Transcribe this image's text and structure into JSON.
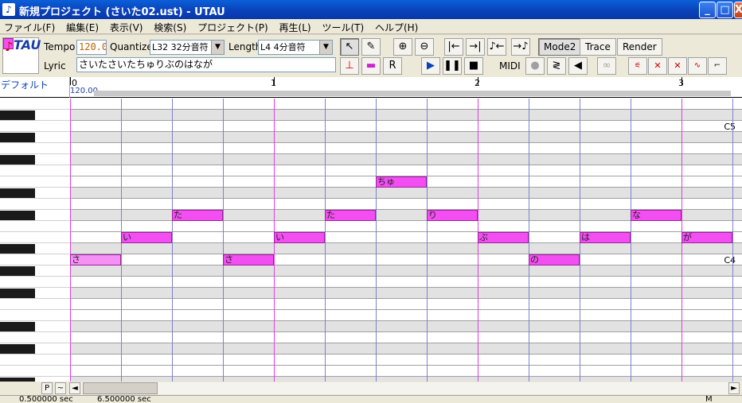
{
  "window": {
    "app_icon": "♪",
    "title": "新規プロジェクト (さいた02.ust) - UTAU",
    "minimize": "_",
    "maximize": "□",
    "close": "X"
  },
  "menu": [
    "ファイル(F)",
    "編集(E)",
    "表示(V)",
    "検索(S)",
    "プロジェクト(P)",
    "再生(L)",
    "ツール(T)",
    "ヘルプ(H)"
  ],
  "toolbar": {
    "logo_note": "♪",
    "logo_text": "UTAU",
    "tempo_label": "Tempo",
    "tempo_value": "120.0",
    "quantize_label": "Quantize",
    "quantize_value": "L32 32分音符",
    "length_label": "Length",
    "length_value": "L4  4分音符",
    "lyric_label": "Lyric",
    "lyric_value": "さいたさいたちゅりぶのはなが",
    "icons": [
      "pointer-icon",
      "pencil-icon",
      "zoom-in-icon",
      "zoom-out-icon",
      "go-start-icon",
      "go-end-icon",
      "note-left-icon",
      "note-right-icon"
    ],
    "mode2": "Mode2",
    "trace": "Trace",
    "render": "Render",
    "midi": "MIDI",
    "accent": "#f24ef2"
  },
  "ruler": {
    "track_name": "デフォルト",
    "measures": [
      "0",
      "1",
      "2",
      "3"
    ],
    "tempo_marker": "120.00"
  },
  "piano": {
    "labels": [
      "C5",
      "C4"
    ]
  },
  "notes": [
    {
      "lyric": "ちゅ"
    },
    {
      "lyric": "た"
    },
    {
      "lyric": "た"
    },
    {
      "lyric": "り"
    },
    {
      "lyric": "な"
    },
    {
      "lyric": "い"
    },
    {
      "lyric": "い"
    },
    {
      "lyric": "ぶ"
    },
    {
      "lyric": "は"
    },
    {
      "lyric": "が"
    },
    {
      "lyric": "さ"
    },
    {
      "lyric": "さ"
    },
    {
      "lyric": "の"
    }
  ],
  "scroll": {
    "p_label": "P",
    "wave_label": "~",
    "left": "◄",
    "right": "►"
  },
  "status": {
    "time1": "0.500000 sec",
    "time2": "6.500000 sec",
    "mode": "M"
  }
}
